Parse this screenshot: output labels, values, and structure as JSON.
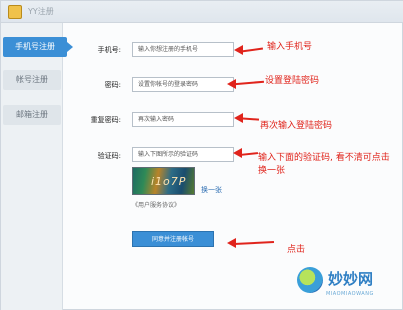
{
  "window": {
    "title": "YY注册"
  },
  "sidebar": {
    "tabs": [
      {
        "label": "手机号注册"
      },
      {
        "label": "帐号注册"
      },
      {
        "label": "邮箱注册"
      }
    ]
  },
  "form": {
    "phone": {
      "label": "手机号:",
      "placeholder": "输入你想注册的手机号"
    },
    "password": {
      "label": "密码:",
      "placeholder": "设置你帐号的登录密码"
    },
    "confirm_password": {
      "label": "重复密码:",
      "placeholder": "再次输入密码"
    },
    "captcha": {
      "label": "验证码:",
      "placeholder": "输入下图所示的验证码",
      "image_text": "i1o7P",
      "refresh_label": "换一张"
    },
    "agreement": "《用户服务协议》",
    "submit_label": "同意并注册帐号"
  },
  "annotations": {
    "phone": "输入手机号",
    "password": "设置登陆密码",
    "confirm": "再次输入登陆密码",
    "captcha": "输入下面的验证码, 看不清可点击换一张",
    "submit": "点击"
  },
  "watermark": {
    "title": "妙妙网",
    "subtitle": "MIAOMIAOWANG"
  },
  "colors": {
    "accent": "#3b8fd6",
    "annotation": "#e0241c",
    "watermark": "#2f7fc4"
  }
}
